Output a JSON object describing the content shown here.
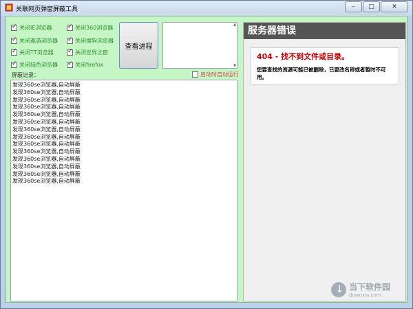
{
  "window": {
    "title": "关联网页弹窗屏蔽工具",
    "controls": [
      "–",
      "□",
      "✕"
    ]
  },
  "checkboxes": {
    "col1": [
      {
        "label": "关闭IE浏览器",
        "checked": true
      },
      {
        "label": "关闭遨游浏览器",
        "checked": true
      },
      {
        "label": "关闭TT浏览器",
        "checked": true
      },
      {
        "label": "关闭绿色浏览器",
        "checked": true
      }
    ],
    "col2": [
      {
        "label": "关闭360浏览器",
        "checked": true
      },
      {
        "label": "关闭搜狗浏览器",
        "checked": true
      },
      {
        "label": "关闭世界之窗",
        "checked": true
      },
      {
        "label": "关闭firefox",
        "checked": true
      }
    ]
  },
  "view_process_button": "查看进程",
  "log": {
    "label": "屏蔽记录：",
    "auto_run": {
      "label": "启动时自动运行",
      "checked": false
    },
    "lines": [
      "发现360se浏览器,自动屏蔽",
      "发现360se浏览器,自动屏蔽",
      "发现360se浏览器,自动屏蔽",
      "发现360se浏览器,自动屏蔽",
      "发现360se浏览器,自动屏蔽",
      "发现360se浏览器,自动屏蔽",
      "发现360se浏览器,自动屏蔽",
      "发现360se浏览器,自动屏蔽",
      "发现360se浏览器,自动屏蔽",
      "发现360se浏览器,自动屏蔽",
      "发现360se浏览器,自动屏蔽",
      "发现360se浏览器,自动屏蔽",
      "发现360se浏览器,自动屏蔽",
      "发现360se浏览器,自动屏蔽"
    ]
  },
  "error_panel": {
    "header": "服务器错误",
    "title": "404 - 找不到文件或目录。",
    "message": "您要查找的资源可能已被删除，已更改名称或者暂时不可用。"
  },
  "watermark": {
    "cn": "当下软件园",
    "en": "downxia.com"
  },
  "colors": {
    "client_bg": "#c6f6c6",
    "checkbox_text": "#2f8f2f",
    "error_red": "#cc0000",
    "header_bg": "#555555"
  }
}
